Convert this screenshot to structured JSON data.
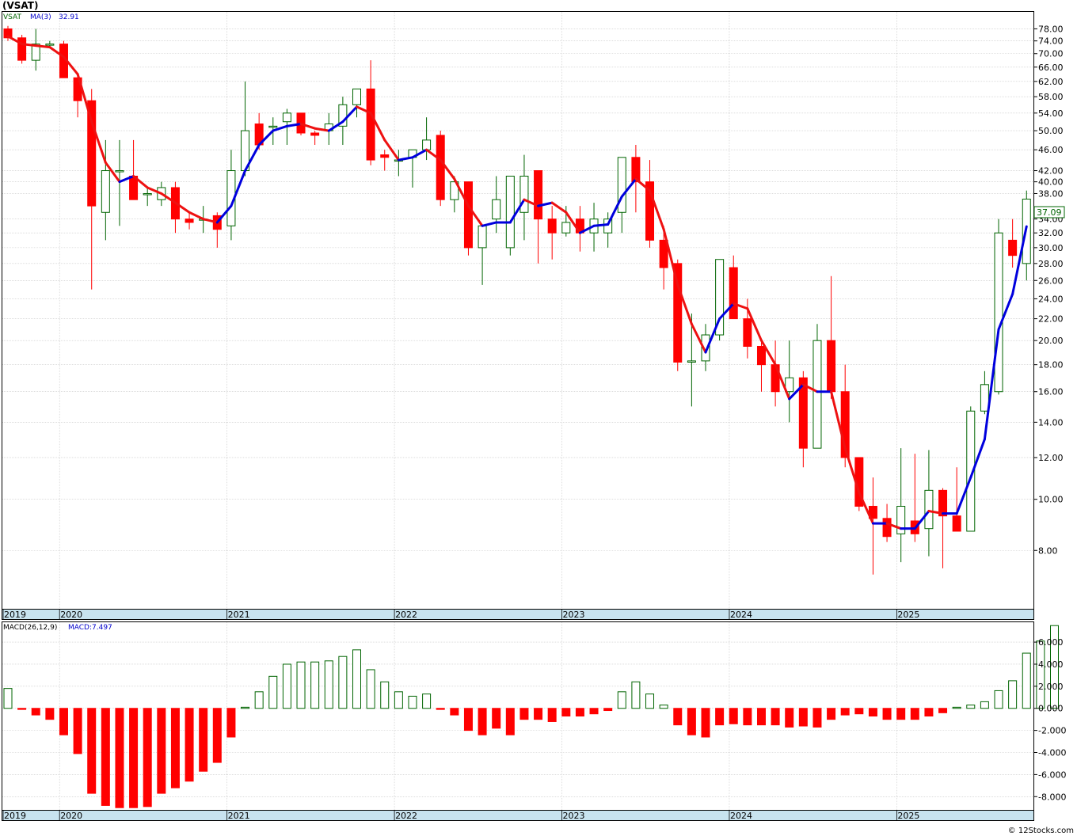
{
  "header": {
    "title": "(VSAT)"
  },
  "price_panel": {
    "ticker_label": "VSAT",
    "ma_label": "MA(3)",
    "ma_value": "32.91",
    "last_price": "37.09"
  },
  "macd_panel": {
    "label": "MACD(26,12,9)",
    "value_label": "MACD:7.497"
  },
  "footer": {
    "credit": "© 12Stocks.com"
  },
  "colors": {
    "up": "#006400",
    "down": "#ff0000",
    "ma_up": "#0000dd",
    "ma_down": "#ee1111",
    "date_bar": "#c8e3ef"
  },
  "chart_data": [
    {
      "type": "candlestick",
      "scale": "log",
      "ylim": [
        6.2,
        84
      ],
      "y_ticks": [
        8,
        10,
        12,
        14,
        16,
        18,
        20,
        22,
        24,
        26,
        28,
        30,
        32,
        34,
        38,
        40,
        42,
        46,
        50,
        54,
        58,
        62,
        66,
        70,
        74,
        78
      ],
      "x_labels": [
        {
          "label": "2019",
          "index": -0.7
        },
        {
          "label": "2020",
          "index": 3.7
        },
        {
          "label": "2021",
          "index": 15.7
        },
        {
          "label": "2022",
          "index": 27.7
        },
        {
          "label": "2023",
          "index": 39.7
        },
        {
          "label": "2024",
          "index": 51.7
        },
        {
          "label": "2025",
          "index": 63.7
        }
      ],
      "candles": [
        [
          78,
          79,
          74,
          75
        ],
        [
          75,
          76,
          67,
          68
        ],
        [
          68,
          78,
          65,
          73
        ],
        [
          73,
          74,
          72,
          73
        ],
        [
          73,
          74,
          63,
          63
        ],
        [
          63,
          64,
          53,
          57
        ],
        [
          57,
          60,
          25,
          36
        ],
        [
          35,
          48,
          31,
          42
        ],
        [
          42,
          48,
          33,
          42
        ],
        [
          41,
          48,
          37,
          37
        ],
        [
          38,
          39,
          36,
          38
        ],
        [
          37,
          40,
          36,
          39
        ],
        [
          39,
          40,
          32,
          34
        ],
        [
          34,
          35,
          32.5,
          33.5
        ],
        [
          34,
          36,
          32,
          34
        ],
        [
          34.5,
          35,
          30,
          32.5
        ],
        [
          33,
          46,
          31,
          42
        ],
        [
          42,
          62,
          41,
          50
        ],
        [
          51.5,
          54,
          46,
          47
        ],
        [
          51,
          53,
          47,
          51
        ],
        [
          52,
          55,
          47,
          54
        ],
        [
          54,
          54,
          49,
          49.5
        ],
        [
          49.5,
          50,
          47,
          49
        ],
        [
          50,
          54,
          47,
          51.5
        ],
        [
          51,
          58,
          47,
          56
        ],
        [
          56,
          60,
          53,
          60
        ],
        [
          60,
          68,
          43,
          44
        ],
        [
          45,
          46,
          42,
          44.5
        ],
        [
          44,
          46,
          41,
          44
        ],
        [
          44.5,
          46,
          39,
          46
        ],
        [
          46,
          53,
          44,
          48
        ],
        [
          49,
          50,
          36,
          37
        ],
        [
          37,
          41,
          35,
          40
        ],
        [
          40,
          40,
          29,
          30
        ],
        [
          30,
          33,
          25.5,
          33
        ],
        [
          34,
          41,
          32,
          37
        ],
        [
          30,
          40,
          29,
          41
        ],
        [
          35,
          45,
          31,
          41
        ],
        [
          42,
          42,
          28,
          34
        ],
        [
          34,
          36,
          28.5,
          32
        ],
        [
          32,
          36,
          31.5,
          33.5
        ],
        [
          34,
          36,
          29.5,
          32
        ],
        [
          32,
          36.5,
          29.5,
          34
        ],
        [
          32,
          35,
          30,
          34
        ],
        [
          35,
          42,
          32,
          44.5
        ],
        [
          44.5,
          47,
          35,
          40
        ],
        [
          40,
          44,
          30,
          31
        ],
        [
          31,
          33,
          25,
          27.5
        ],
        [
          28,
          28.5,
          17.5,
          18.2
        ],
        [
          18.2,
          22.5,
          15,
          18.3
        ],
        [
          18.3,
          21.5,
          17.5,
          20.5
        ],
        [
          20.5,
          28.5,
          20,
          28.5
        ],
        [
          27.5,
          29,
          22,
          22
        ],
        [
          22,
          24,
          18.5,
          19.5
        ],
        [
          19.5,
          20,
          16,
          18
        ],
        [
          18,
          20,
          15,
          16
        ],
        [
          16,
          20,
          14,
          17
        ],
        [
          17,
          17.5,
          11.5,
          12.5
        ],
        [
          12.5,
          21.5,
          12.5,
          20
        ],
        [
          20,
          26.5,
          15.5,
          16
        ],
        [
          16,
          18,
          11.5,
          12
        ],
        [
          12,
          12,
          9.5,
          9.7
        ],
        [
          9.7,
          11,
          7.2,
          9.2
        ],
        [
          9.2,
          9.8,
          8.3,
          8.5
        ],
        [
          8.6,
          12.5,
          7.6,
          9.7
        ],
        [
          9.1,
          12.2,
          8.3,
          8.6
        ],
        [
          8.8,
          12.4,
          7.8,
          10.4
        ],
        [
          10.4,
          10.5,
          7.4,
          9.3
        ],
        [
          9.3,
          11.5,
          8.7,
          8.7
        ],
        [
          8.7,
          15,
          8.7,
          14.7
        ],
        [
          14.7,
          17.5,
          14.5,
          16.5
        ],
        [
          16,
          34,
          15.8,
          32
        ],
        [
          31,
          34,
          27.5,
          29
        ],
        [
          28,
          38.5,
          26,
          37.09
        ]
      ],
      "ma": [
        75.5,
        73,
        72.5,
        72,
        69,
        64,
        52,
        43.5,
        40,
        41,
        39,
        38,
        36.5,
        35,
        34,
        33.5,
        36,
        42,
        47,
        50,
        51,
        51.5,
        50.5,
        50,
        52,
        55.5,
        54,
        48,
        44,
        44.5,
        46,
        44,
        40.5,
        36,
        33,
        33.5,
        33.5,
        37,
        36,
        36.5,
        35,
        32,
        33,
        33.2,
        37.5,
        40.5,
        38.5,
        32.5,
        25.5,
        21.5,
        19,
        22,
        23.5,
        23,
        20,
        18,
        15.5,
        16.5,
        16,
        16,
        12.5,
        10.3,
        9,
        9,
        8.8,
        8.8,
        9.5,
        9.4,
        9.4,
        11,
        13,
        21,
        24.5,
        32.91
      ],
      "macd_hist": [
        1.8,
        -0.1,
        -0.6,
        -1.0,
        -2.4,
        -4.1,
        -7.7,
        -8.8,
        -9.0,
        -9.0,
        -8.9,
        -7.7,
        -7.2,
        -6.6,
        -5.7,
        -4.9,
        -2.6,
        0.1,
        1.5,
        2.9,
        4.0,
        4.2,
        4.2,
        4.3,
        4.7,
        5.3,
        3.5,
        2.4,
        1.5,
        1.1,
        1.3,
        -0.1,
        -0.6,
        -2.0,
        -2.4,
        -1.8,
        -2.4,
        -1.0,
        -1.0,
        -1.2,
        -0.7,
        -0.7,
        -0.5,
        -0.2,
        1.5,
        2.4,
        1.3,
        0.3,
        -1.5,
        -2.4,
        -2.6,
        -1.5,
        -1.4,
        -1.5,
        -1.5,
        -1.5,
        -1.7,
        -1.6,
        -1.7,
        -1.0,
        -0.6,
        -0.5,
        -0.7,
        -1.0,
        -1.0,
        -1.0,
        -0.7,
        -0.4,
        0.1,
        0.3,
        0.6,
        1.6,
        2.5,
        5.0,
        6.1,
        7.497
      ],
      "macd_ylim": [
        -9.2,
        7.8
      ],
      "macd_ticks": [
        -8,
        -6,
        -4,
        -2,
        0,
        2,
        4,
        6
      ]
    }
  ]
}
